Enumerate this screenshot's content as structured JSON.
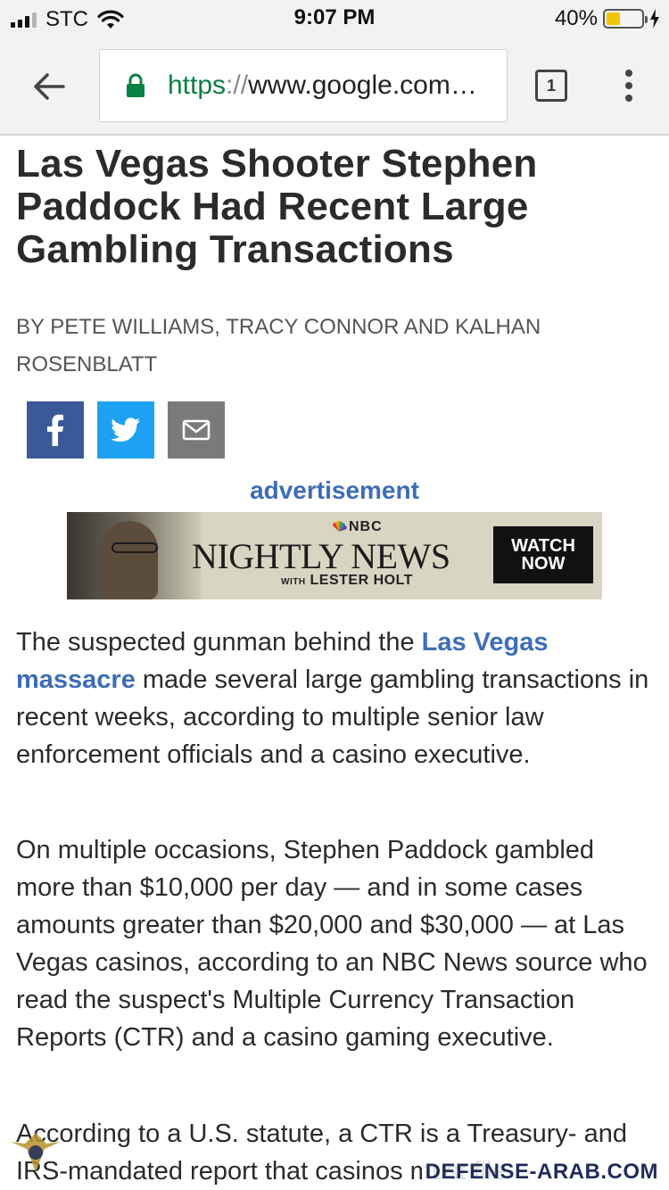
{
  "status_bar": {
    "carrier": "STC",
    "time": "9:07 PM",
    "battery_percent": "40%",
    "battery_level": 0.4,
    "signal_bars": 3
  },
  "browser": {
    "url_scheme": "https",
    "url_separator": "://",
    "url_host": "www.google.com…",
    "tab_count": "1"
  },
  "article": {
    "headline": "Las Vegas Shooter Stephen Paddock Had Recent Large Gambling Transactions",
    "byline": "BY PETE WILLIAMS, TRACY CONNOR AND KALHAN ROSENBLATT",
    "ad_label": "advertisement",
    "ad": {
      "brand": "NBC",
      "title": "NIGHTLY NEWS",
      "subtitle_prefix": "WITH",
      "subtitle": "LESTER HOLT",
      "cta": "WATCH NOW"
    },
    "p1": {
      "before": "The suspected gunman behind the ",
      "link": "Las Vegas massacre",
      "after": " made several large gambling transactions in recent weeks, according to multiple senior law enforcement officials and a casino executive."
    },
    "p2": "On multiple occasions, Stephen Paddock gambled more than $10,000 per day — and in some cases amounts greater than $20,000 and $30,000 — at Las Vegas casinos, according to an NBC News source who read the suspect's Multiple Currency Transaction Reports (CTR) and a casino gaming executive.",
    "p3": "According to a U.S. statute, a CTR is a Treasury- and IRS-mandated report that casinos must file"
  },
  "watermark": {
    "text": "DEFENSE-ARAB.COM"
  },
  "colors": {
    "link": "#3d6db8",
    "facebook": "#3b5998",
    "twitter": "#1da1f2",
    "email": "#7a7a7a",
    "lock": "#0b8043",
    "battery": "#f4c400"
  }
}
